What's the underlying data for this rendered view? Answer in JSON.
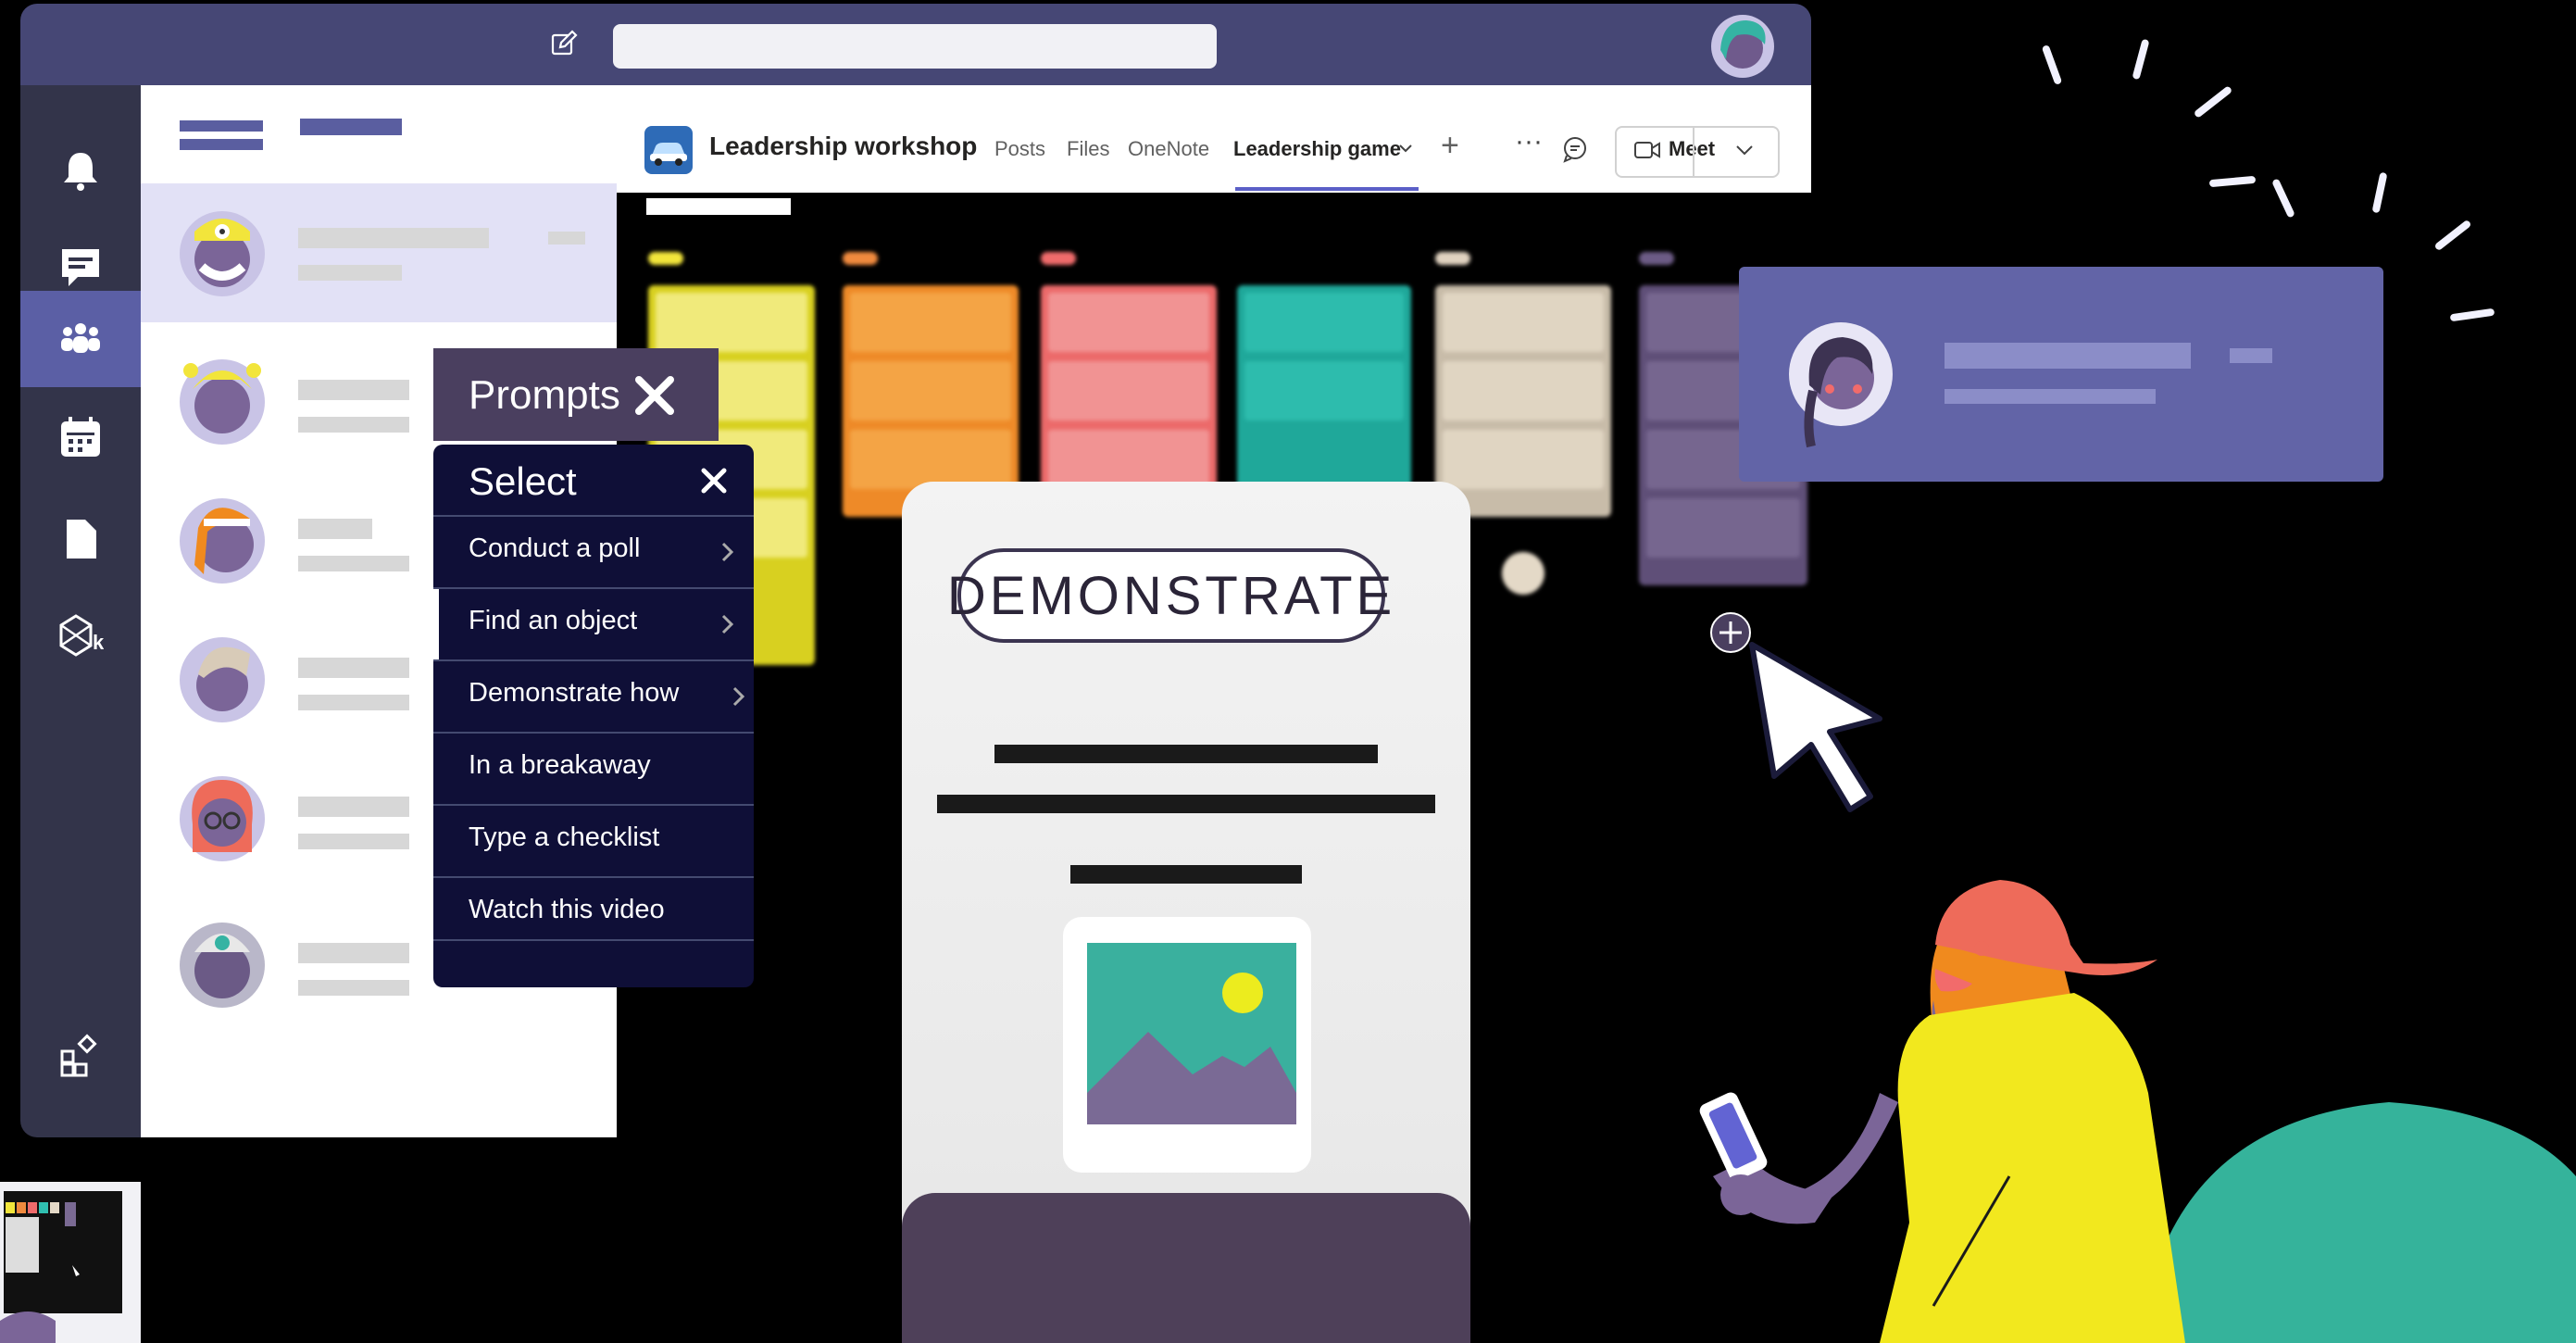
{
  "team": {
    "name": "Leadership workshop",
    "tabs": [
      "Posts",
      "Files",
      "OneNote",
      "Leadership game"
    ],
    "active_tab": "Leadership game",
    "meet_label": "Meet"
  },
  "rail": {
    "items": [
      "bell-icon",
      "chat-icon",
      "teams-icon",
      "calendar-icon",
      "files-icon",
      "app-k-icon",
      "apps-icon"
    ],
    "active": "teams-icon"
  },
  "prompts": {
    "title": "Prompts",
    "select_title": "Select",
    "items": [
      {
        "label": "Conduct a poll",
        "has_submenu": true
      },
      {
        "label": "Find an object",
        "has_submenu": true
      },
      {
        "label": "Demonstrate how",
        "has_submenu": true
      },
      {
        "label": "In a breakaway",
        "has_submenu": false
      },
      {
        "label": "Type a checklist",
        "has_submenu": false
      },
      {
        "label": "Watch this video",
        "has_submenu": false
      }
    ],
    "active_item": "Find an object"
  },
  "card": {
    "badge": "DEMONSTRATE"
  },
  "colors": {
    "teams_purple": "#464775",
    "rail": "#33344a",
    "accent": "#5b5fc7",
    "prompt_panel": "#0f0f37",
    "person_card": "#6264a7"
  }
}
